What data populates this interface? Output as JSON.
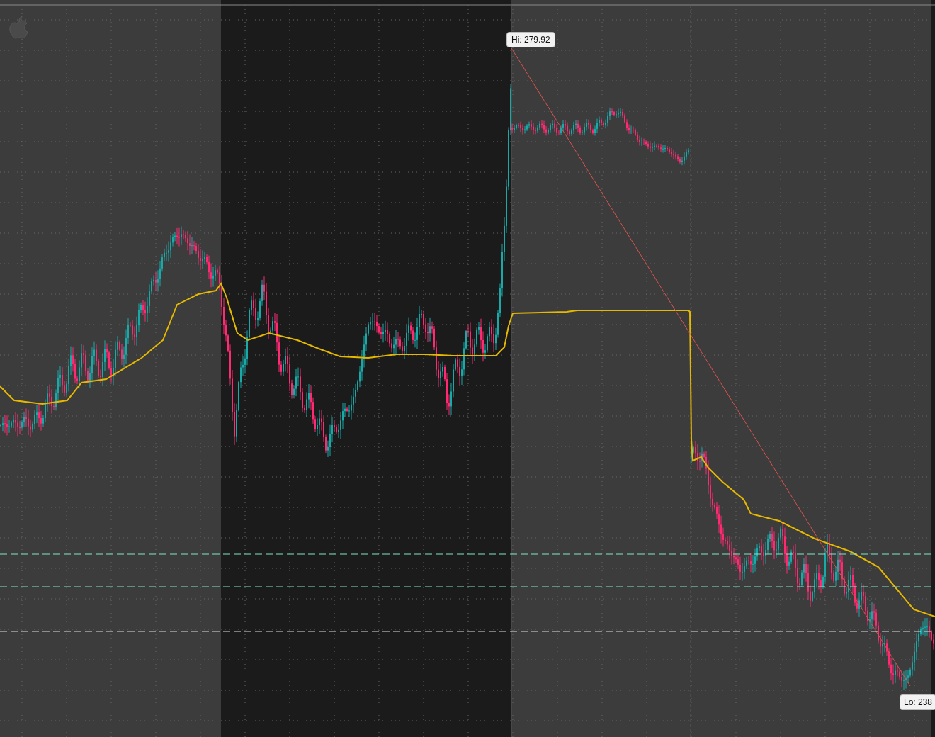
{
  "chart": {
    "high_label": "Hi: 279.92",
    "low_label": "Lo: 238"
  }
}
